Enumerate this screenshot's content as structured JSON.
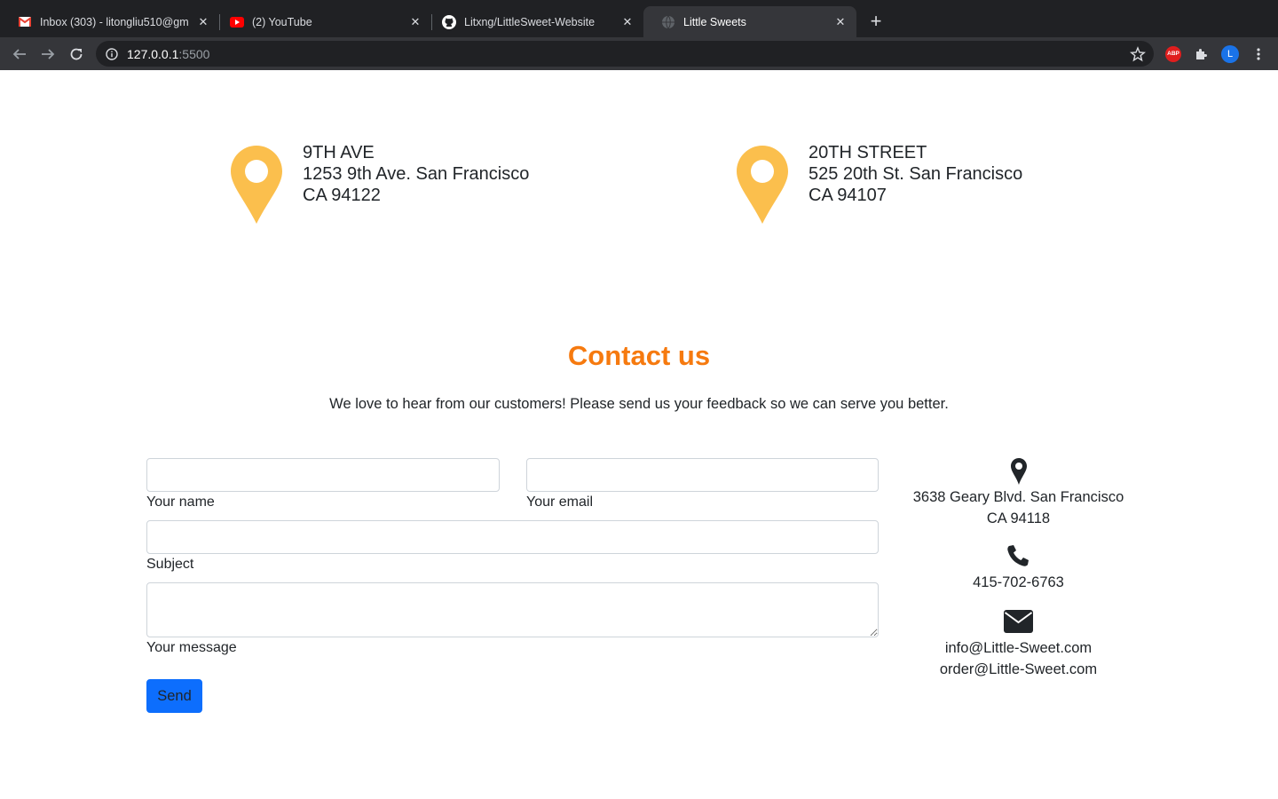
{
  "browser": {
    "tabs": [
      {
        "title": "Inbox (303) - litongliu510@gm",
        "icon": "gmail-icon"
      },
      {
        "title": "(2) YouTube",
        "icon": "youtube-icon"
      },
      {
        "title": "Litxng/LittleSweet-Website",
        "icon": "github-icon"
      },
      {
        "title": "Little Sweets",
        "icon": "globe-icon",
        "active": true
      }
    ],
    "url_host": "127.0.0.1",
    "url_port": ":5500",
    "extensions": {
      "abp_label": "ABP",
      "profile_initial": "L"
    }
  },
  "locations": [
    {
      "name": "9TH AVE",
      "street": "1253 9th Ave. San Francisco",
      "city": "CA 94122"
    },
    {
      "name": "20TH STREET",
      "street": "525 20th St. San Francisco",
      "city": "CA 94107"
    }
  ],
  "contact": {
    "title": "Contact us",
    "subtitle": "We love to hear from our customers! Please send us your feedback so we can serve you better.",
    "form": {
      "name_label": "Your name",
      "email_label": "Your email",
      "subject_label": "Subject",
      "message_label": "Your message",
      "send_label": "Send"
    },
    "info": {
      "address_line1": "3638 Geary Blvd. San Francisco",
      "address_line2": "CA 94118",
      "phone": "415-702-6763",
      "email1": "info@Little-Sweet.com",
      "email2": "order@Little-Sweet.com"
    }
  },
  "colors": {
    "accent": "#f67a0f",
    "pin": "#fbbf4d",
    "button": "#0d6efd"
  }
}
